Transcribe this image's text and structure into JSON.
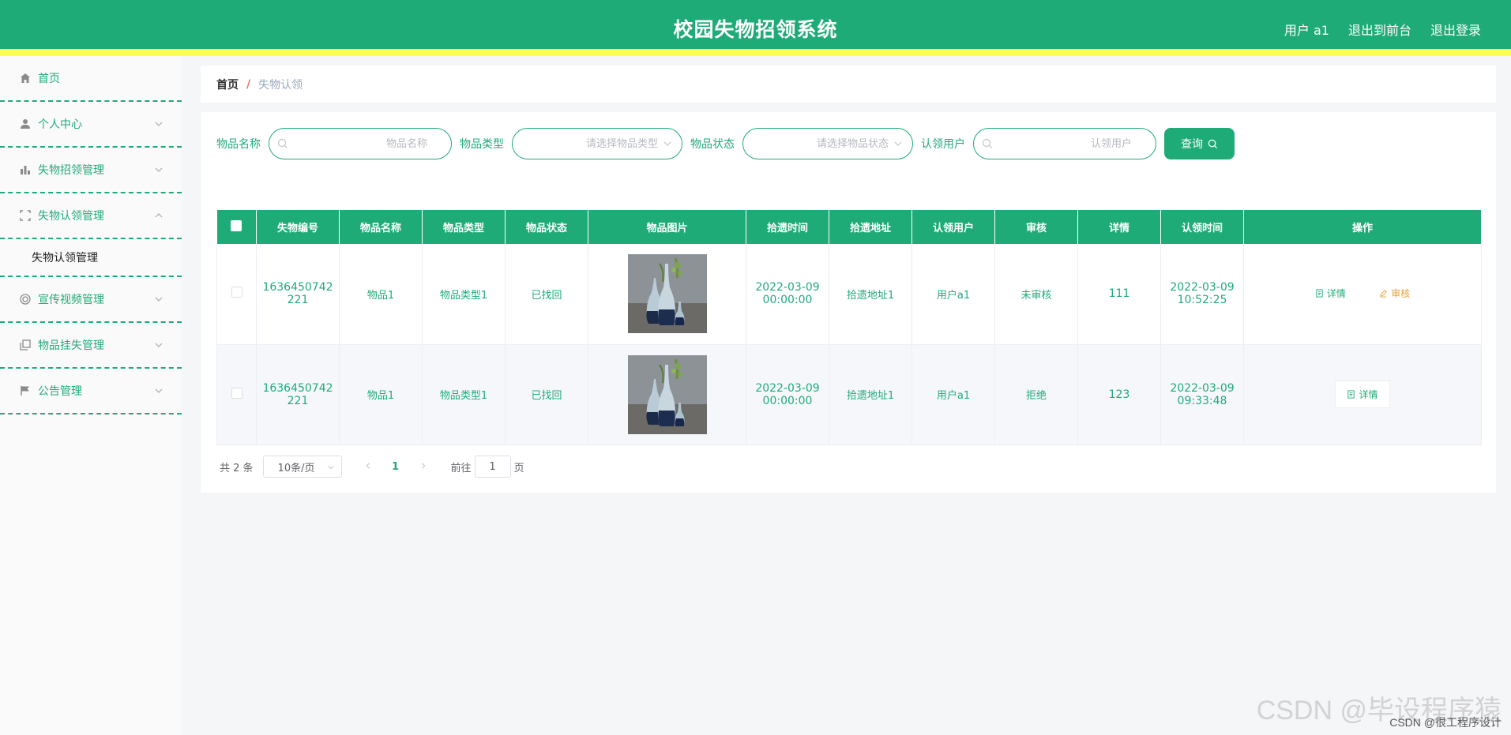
{
  "header": {
    "title": "校园失物招领系统",
    "user_label": "用户 a1",
    "to_front": "退出到前台",
    "logout": "退出登录"
  },
  "sidebar": {
    "items": [
      {
        "label": "首页",
        "icon": "home-icon"
      },
      {
        "label": "个人中心",
        "icon": "user-icon"
      },
      {
        "label": "失物招领管理",
        "icon": "bar-chart-icon"
      },
      {
        "label": "失物认领管理",
        "icon": "scan-icon",
        "expanded": true
      },
      {
        "label": "失物认领管理",
        "sub": true
      },
      {
        "label": "宣传视频管理",
        "icon": "video-icon"
      },
      {
        "label": "物品挂失管理",
        "icon": "copy-icon"
      },
      {
        "label": "公告管理",
        "icon": "flag-icon"
      }
    ]
  },
  "breadcrumb": {
    "home": "首页",
    "sep": "/",
    "current": "失物认领"
  },
  "search": {
    "name_label": "物品名称",
    "name_placeholder": "物品名称",
    "type_label": "物品类型",
    "type_placeholder": "请选择物品类型",
    "status_label": "物品状态",
    "status_placeholder": "请选择物品状态",
    "user_label": "认领用户",
    "user_placeholder": "认领用户",
    "query_button": "查询"
  },
  "table": {
    "headers": [
      "失物编号",
      "物品名称",
      "物品类型",
      "物品状态",
      "物品图片",
      "拾遗时间",
      "拾遗地址",
      "认领用户",
      "审核",
      "详情",
      "认领时间",
      "操作"
    ],
    "rows": [
      {
        "id_line1": "1636450742",
        "id_line2": "221",
        "name": "物品1",
        "type": "物品类型1",
        "status": "已找回",
        "pick_date": "2022-03-09",
        "pick_time": "00:00:00",
        "address": "拾遗地址1",
        "user": "用户a1",
        "review": "未审核",
        "detail": "111",
        "claim_date": "2022-03-09",
        "claim_time": "10:52:25"
      },
      {
        "id_line1": "1636450742",
        "id_line2": "221",
        "name": "物品1",
        "type": "物品类型1",
        "status": "已找回",
        "pick_date": "2022-03-09",
        "pick_time": "00:00:00",
        "address": "拾遗地址1",
        "user": "用户a1",
        "review": "拒绝",
        "detail": "123",
        "claim_date": "2022-03-09",
        "claim_time": "09:33:48"
      }
    ],
    "op_detail": "详情",
    "op_audit": "审核"
  },
  "pager": {
    "total": "共 2 条",
    "page_size": "10条/页",
    "current": "1",
    "goto_label": "前往",
    "goto_value": "1",
    "page_unit": "页"
  },
  "watermark": {
    "big": "CSDN @毕设程序猿",
    "small": "CSDN @很工程序设计"
  },
  "colors": {
    "primary": "#1fab78",
    "stripe": "#faff5a",
    "warning": "#e6a23c"
  }
}
